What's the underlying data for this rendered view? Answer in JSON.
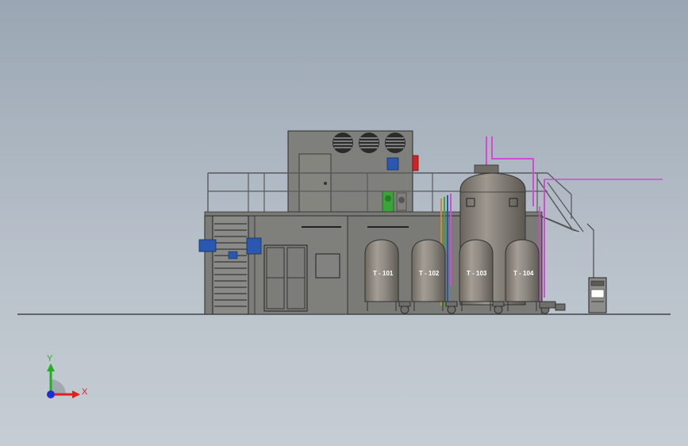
{
  "scene": {
    "tanks": [
      {
        "label": "T - 101"
      },
      {
        "label": "T - 102"
      },
      {
        "label": "T - 103"
      },
      {
        "label": "T - 104"
      }
    ]
  },
  "triad": {
    "y_label": "Y",
    "x_label": "X"
  },
  "colors": {
    "background": "#a9b3be",
    "structure": "#7d7d7a",
    "tank": "#8f8a82",
    "blue_panel": "#2a58b0",
    "red_panel": "#d32222",
    "green_pump": "#3aa43a",
    "pipe_magenta": "#d24bd2",
    "axis_x": "#e02020",
    "axis_y": "#20b020",
    "axis_z": "#2030d0"
  }
}
